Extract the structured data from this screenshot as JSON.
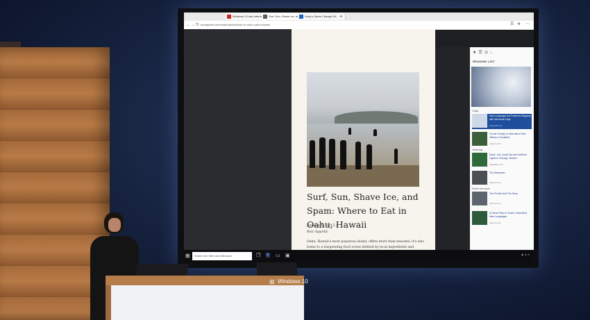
{
  "browser": {
    "tabs": [
      {
        "label": "Windows 10 has Internet Ex..."
      },
      {
        "label": "Surf, Sun, Shave Ice, an..."
      },
      {
        "label": "Sony's Game Change Sh..."
      }
    ],
    "new_tab": "+",
    "url": "bonappetit.com/restaurants/where-to-eat-in-oahu-hawaii"
  },
  "article": {
    "headline": "Surf, Sun, Shave Ice, and Spam: Where to Eat in Oahu, Hawaii",
    "date": "January 8, 2015 /",
    "source": "Bon Appétit",
    "body": "Oahu, Hawaii's most populous island, offers more than beaches: it's also home to a burgeoning food scene defined by local ingredients and tradition all of it kind treats."
  },
  "reading_list": {
    "title": "READING LIST",
    "sections": [
      {
        "label": "Today"
      },
      {
        "label": "Yesterday"
      },
      {
        "label": "Earlier this week"
      }
    ],
    "items": [
      {
        "title": "New Language and Features Mapping with Microsoft Edge",
        "source": "microsoft.com",
        "selected": true
      },
      {
        "title": "On the Hunt(s): A Visit with a Rich History in Scotland",
        "source": "nytimes.com",
        "selected": false
      },
      {
        "title": "Move: You Could See the Northern Lights in Chicago, Boston",
        "source": "mashable.com",
        "selected": false
      },
      {
        "title": "The Sleepover",
        "source": "nytimes.com",
        "selected": false
      },
      {
        "title": "The Poodle And The Story",
        "source": "nytimes.com",
        "selected": false
      },
      {
        "title": "A Clever Plan to Teach Colourblind New Languages",
        "source": "nytimes.com",
        "selected": false
      }
    ]
  },
  "taskbar": {
    "search_placeholder": "Search the Web and Windows"
  },
  "podium": {
    "brand": "Windows 10"
  }
}
